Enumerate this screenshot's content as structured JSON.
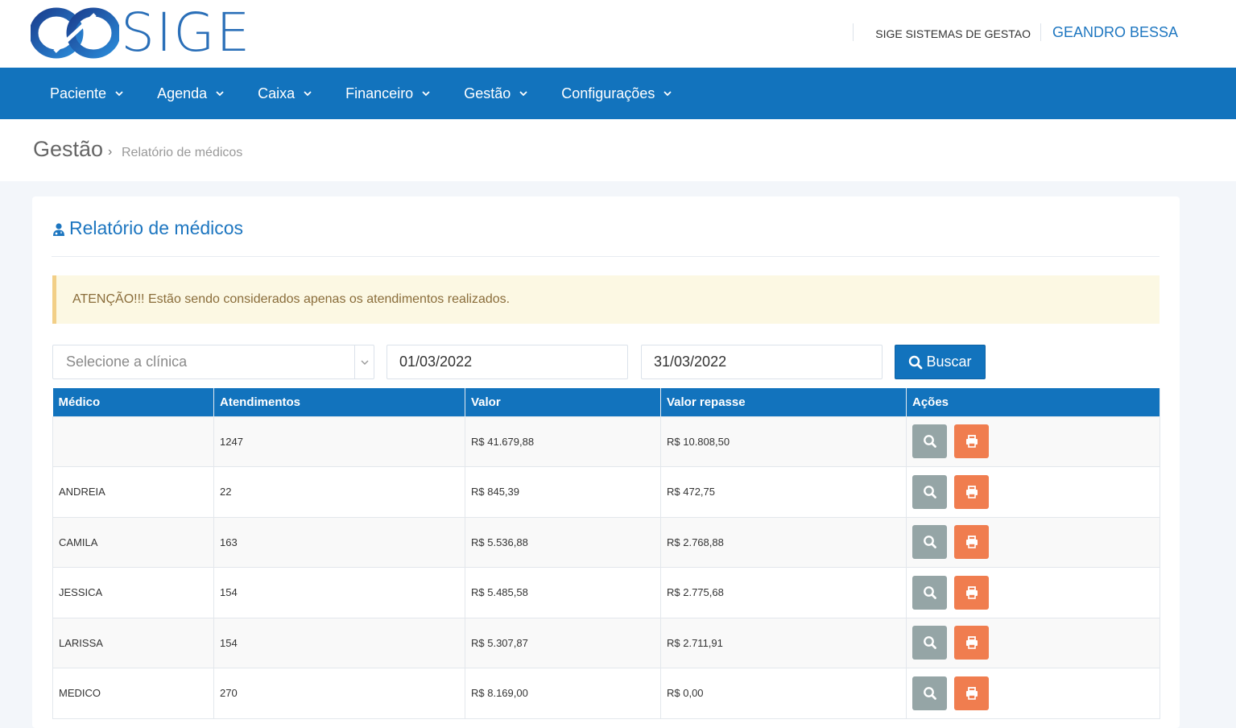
{
  "header": {
    "logo_text": "SIGE",
    "company": "SIGE SISTEMAS DE GESTAO",
    "user": "GEANDRO BESSA"
  },
  "nav": {
    "items": [
      "Paciente",
      "Agenda",
      "Caixa",
      "Financeiro",
      "Gestão",
      "Configurações"
    ]
  },
  "breadcrumb": {
    "section": "Gestão",
    "separator": "›",
    "page": "Relatório de médicos"
  },
  "card": {
    "title": "Relatório de médicos",
    "alert": "ATENÇÃO!!! Estão sendo considerados apenas os atendimentos realizados."
  },
  "filters": {
    "clinic_placeholder": "Selecione a clínica",
    "date_start": "01/03/2022",
    "date_end": "31/03/2022",
    "search_label": "Buscar"
  },
  "table": {
    "headers": [
      "Médico",
      "Atendimentos",
      "Valor",
      "Valor repasse",
      "Ações"
    ],
    "rows": [
      {
        "medico": "",
        "atendimentos": "1247",
        "valor": "R$ 41.679,88",
        "repasse": "R$ 10.808,50"
      },
      {
        "medico": "ANDREIA",
        "atendimentos": "22",
        "valor": "R$ 845,39",
        "repasse": "R$ 472,75"
      },
      {
        "medico": "CAMILA",
        "atendimentos": "163",
        "valor": "R$ 5.536,88",
        "repasse": "R$ 2.768,88"
      },
      {
        "medico": "JESSICA",
        "atendimentos": "154",
        "valor": "R$ 5.485,58",
        "repasse": "R$ 2.775,68"
      },
      {
        "medico": "LARISSA",
        "atendimentos": "154",
        "valor": "R$ 5.307,87",
        "repasse": "R$ 2.711,91"
      },
      {
        "medico": "MEDICO",
        "atendimentos": "270",
        "valor": "R$ 8.169,00",
        "repasse": "R$ 0,00"
      }
    ]
  },
  "colors": {
    "primary": "#1273bd",
    "view_button": "#95a5a6",
    "print_button": "#f07d4f",
    "alert_bg": "#fcf8e3"
  }
}
